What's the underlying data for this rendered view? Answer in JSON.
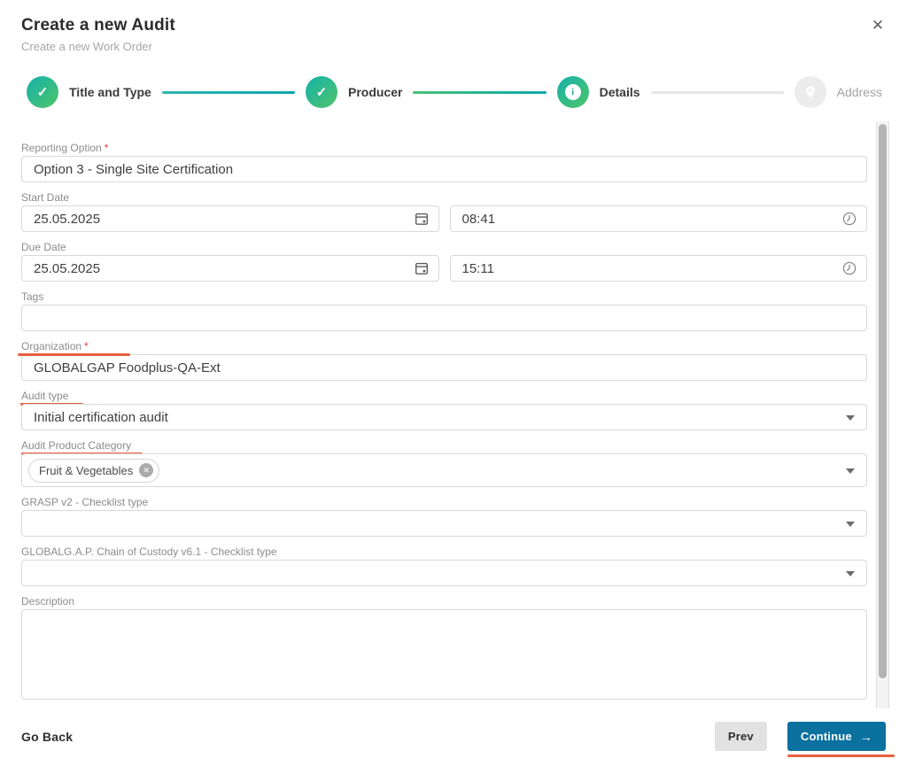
{
  "dialog": {
    "title": "Create a new Audit",
    "subtitle": "Create a new Work Order"
  },
  "icons": {
    "close": "✕",
    "check": "✓",
    "info": "i",
    "arrow_right": "→",
    "chip_remove": "✕"
  },
  "stepper": {
    "steps": [
      {
        "label": "Title and Type",
        "state": "completed"
      },
      {
        "label": "Producer",
        "state": "completed"
      },
      {
        "label": "Details",
        "state": "active"
      },
      {
        "label": "Address",
        "state": "pending"
      }
    ]
  },
  "form": {
    "reporting_option": {
      "label": "Reporting Option",
      "required": "*",
      "value": "Option 3 - Single Site Certification"
    },
    "start_date": {
      "label": "Start Date",
      "date": "25.05.2025",
      "time": "08:41"
    },
    "due_date": {
      "label": "Due Date",
      "date": "25.05.2025",
      "time": "15:11"
    },
    "tags": {
      "label": "Tags",
      "value": ""
    },
    "organization": {
      "label": "Organization",
      "required": "*",
      "value": "GLOBALGAP Foodplus-QA-Ext"
    },
    "audit_type": {
      "label": "Audit type",
      "value": "Initial certification audit"
    },
    "audit_product_category": {
      "label": "Audit Product Category",
      "chips": [
        {
          "label": "Fruit & Vegetables"
        }
      ]
    },
    "grasp_checklist": {
      "label": "GRASP v2 - Checklist type",
      "value": ""
    },
    "coc_checklist": {
      "label": "GLOBALG.A.P. Chain of Custody v6.1 - Checklist type",
      "value": ""
    },
    "description": {
      "label": "Description",
      "value": ""
    }
  },
  "footer": {
    "go_back_label": "Go Back",
    "prev_label": "Prev",
    "continue_label": "Continue"
  },
  "colors": {
    "step_gradient_start": "#17b3a6",
    "step_gradient_end": "#4cc36c",
    "connector_teal": "#0fa4ae",
    "connector_pending": "#e5e5e5",
    "continue_button": "#0b719f",
    "prev_button": "#e2e2e2",
    "annotation_marker": "#e8512d",
    "required_asterisk": "#e53935",
    "input_border": "#d8d8d8"
  }
}
